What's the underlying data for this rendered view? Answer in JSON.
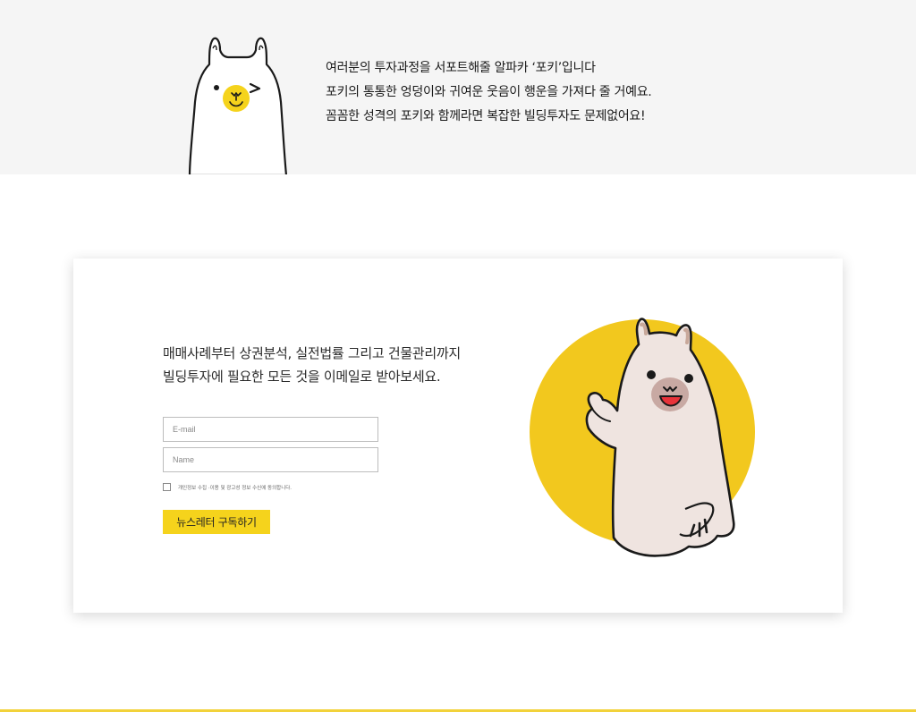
{
  "intro": {
    "lines": [
      "여러분의 투자과정을 서포트해줄 알파카 ‘포키’입니다",
      "포키의 통통한 엉덩이와 귀여운 웃음이 행운을 가져다 줄 거예요.",
      "꼼꼼한 성격의 포키와 함께라면 복잡한 빌딩투자도 문제없어요!"
    ]
  },
  "newsletter": {
    "headline": [
      "매매사례부터 상권분석, 실전법률 그리고 건물관리까지",
      "빌딩투자에 필요한 모든 것을 이메일로 받아보세요."
    ],
    "email_placeholder": "E-mail",
    "name_placeholder": "Name",
    "consent_label": "개인정보 수집 ·이용 및 광고성 정보 수신에 동의합니다.",
    "consent_checked": false,
    "subscribe_label": "뉴스레터 구독하기"
  },
  "icons": {
    "banner_mascot": "alpaca-peek-icon",
    "card_mascot": "alpaca-wave-icon"
  },
  "colors": {
    "banner_bg": "#f5f5f5",
    "accent_yellow": "#f5d31c",
    "circle_yellow": "#f2c81e",
    "alpaca_body": "#efe4e0",
    "alpaca_ear": "#c8a89a",
    "alpaca_muzzle": "#c8a9a3",
    "outline": "#1a1a1a"
  }
}
